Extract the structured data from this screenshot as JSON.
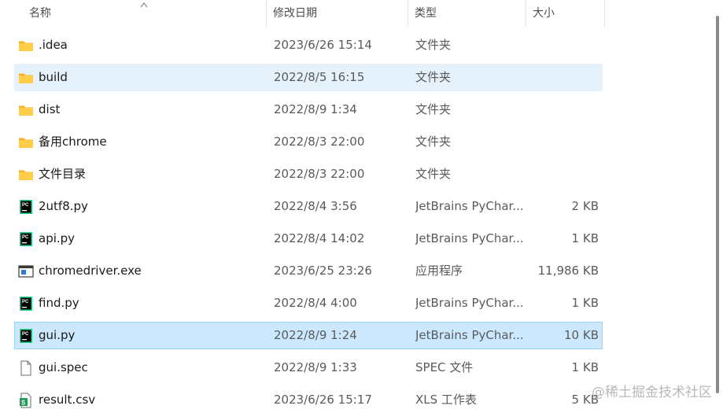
{
  "header": {
    "name": "名称",
    "date": "修改日期",
    "type": "类型",
    "size": "大小"
  },
  "rows": [
    {
      "name": ".idea",
      "date": "2023/6/26 15:14",
      "type": "文件夹",
      "size": "",
      "icon": "folder-icon",
      "state": "normal"
    },
    {
      "name": "build",
      "date": "2022/8/5 16:15",
      "type": "文件夹",
      "size": "",
      "icon": "folder-icon",
      "state": "hover"
    },
    {
      "name": "dist",
      "date": "2022/8/9 1:34",
      "type": "文件夹",
      "size": "",
      "icon": "folder-icon",
      "state": "normal"
    },
    {
      "name": "备用chrome",
      "date": "2022/8/3 22:00",
      "type": "文件夹",
      "size": "",
      "icon": "folder-icon",
      "state": "normal"
    },
    {
      "name": "文件目录",
      "date": "2022/8/3 22:00",
      "type": "文件夹",
      "size": "",
      "icon": "folder-icon",
      "state": "normal"
    },
    {
      "name": "2utf8.py",
      "date": "2022/8/4 3:56",
      "type": "JetBrains PyChar...",
      "size": "2 KB",
      "icon": "pycharm-file-icon",
      "state": "normal"
    },
    {
      "name": "api.py",
      "date": "2022/8/4 14:02",
      "type": "JetBrains PyChar...",
      "size": "1 KB",
      "icon": "pycharm-file-icon",
      "state": "normal"
    },
    {
      "name": "chromedriver.exe",
      "date": "2023/6/25 23:26",
      "type": "应用程序",
      "size": "11,986 KB",
      "icon": "exe-icon",
      "state": "normal"
    },
    {
      "name": "find.py",
      "date": "2022/8/4 4:00",
      "type": "JetBrains PyChar...",
      "size": "1 KB",
      "icon": "pycharm-file-icon",
      "state": "normal"
    },
    {
      "name": "gui.py",
      "date": "2022/8/9 1:24",
      "type": "JetBrains PyChar...",
      "size": "10 KB",
      "icon": "pycharm-file-icon",
      "state": "selected"
    },
    {
      "name": "gui.spec",
      "date": "2022/8/9 1:33",
      "type": "SPEC 文件",
      "size": "1 KB",
      "icon": "blank-file-icon",
      "state": "normal"
    },
    {
      "name": "result.csv",
      "date": "2023/6/26 15:17",
      "type": "XLS 工作表",
      "size": "5 KB",
      "icon": "spreadsheet-file-icon",
      "state": "normal"
    }
  ],
  "watermark": "@稀土掘金技术社区",
  "colors": {
    "hover_bg": "#e5f1fb",
    "selected_bg": "#cce8ff",
    "selected_border": "#99d1ff",
    "folder": "#ffc83d",
    "pycharm_green": "#21d789"
  }
}
